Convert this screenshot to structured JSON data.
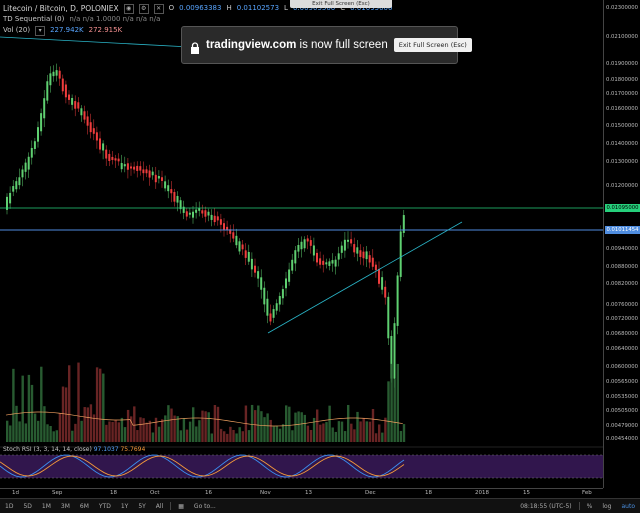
{
  "legend": {
    "symbol_line": "Litecoin / Bitcoin, D, POLONIEX",
    "ohlc": [
      {
        "label": "O",
        "value": "0.00963383"
      },
      {
        "label": "H",
        "value": "0.01102573"
      },
      {
        "label": "L",
        "value": "0.00905500"
      },
      {
        "label": "C",
        "value": "0.01095000"
      }
    ],
    "td_line": "TD Sequential (0)",
    "td_values": "n/a  n/a  1.0000  n/a  n/a  n/a",
    "vol_line": "Vol (20)",
    "vol_value_1": "227.942K",
    "vol_value_2": "272.915K"
  },
  "top_hint": "Exit Full Screen (Esc)",
  "fullscreen_banner": {
    "site": "tradingview.com",
    "message": " is now full screen",
    "exit_button": "Exit Full Screen (Esc)"
  },
  "price_axis": {
    "labels": [
      "0.02300000",
      "0.02100000",
      "0.01900000",
      "0.01800000",
      "0.01700000",
      "0.01600000",
      "0.01500000",
      "0.01400000",
      "0.01300000",
      "0.01200000",
      "0.01000000",
      "0.00940000",
      "0.00880000",
      "0.00820000",
      "0.00760000",
      "0.00720000",
      "0.00680000",
      "0.00640000",
      "0.00600000",
      "0.00565000",
      "0.00535000",
      "0.00505000",
      "0.00479000",
      "0.00454000"
    ],
    "current_price_tag": "0.01095000",
    "level_tag": "0.01011454",
    "current_color": "#26d07c",
    "level_color": "#4f8de0"
  },
  "time_axis": [
    "1d",
    "Sep",
    "18",
    "Oct",
    "16",
    "Nov",
    "13",
    "Dec",
    "18",
    "2018",
    "15",
    "Feb"
  ],
  "stoch": {
    "legend": "Stoch RSI (3, 3, 14, 14, close)",
    "k_value": "97.1037",
    "d_value": "75.7694",
    "k_color": "#3b8ef0",
    "d_color": "#f59a3b",
    "band_color": "#3a1a5a"
  },
  "bottom_bar": {
    "ranges": [
      "1D",
      "5D",
      "1M",
      "3M",
      "6M",
      "YTD",
      "1Y",
      "5Y",
      "All"
    ],
    "goto": "Go to...",
    "time": "08:18:55 (UTC-5)",
    "percent": "%",
    "log": "log",
    "auto": "auto"
  },
  "colors": {
    "up": "#5fd071",
    "down": "#ef3d3d",
    "trendline": "#2ab5c8"
  }
}
